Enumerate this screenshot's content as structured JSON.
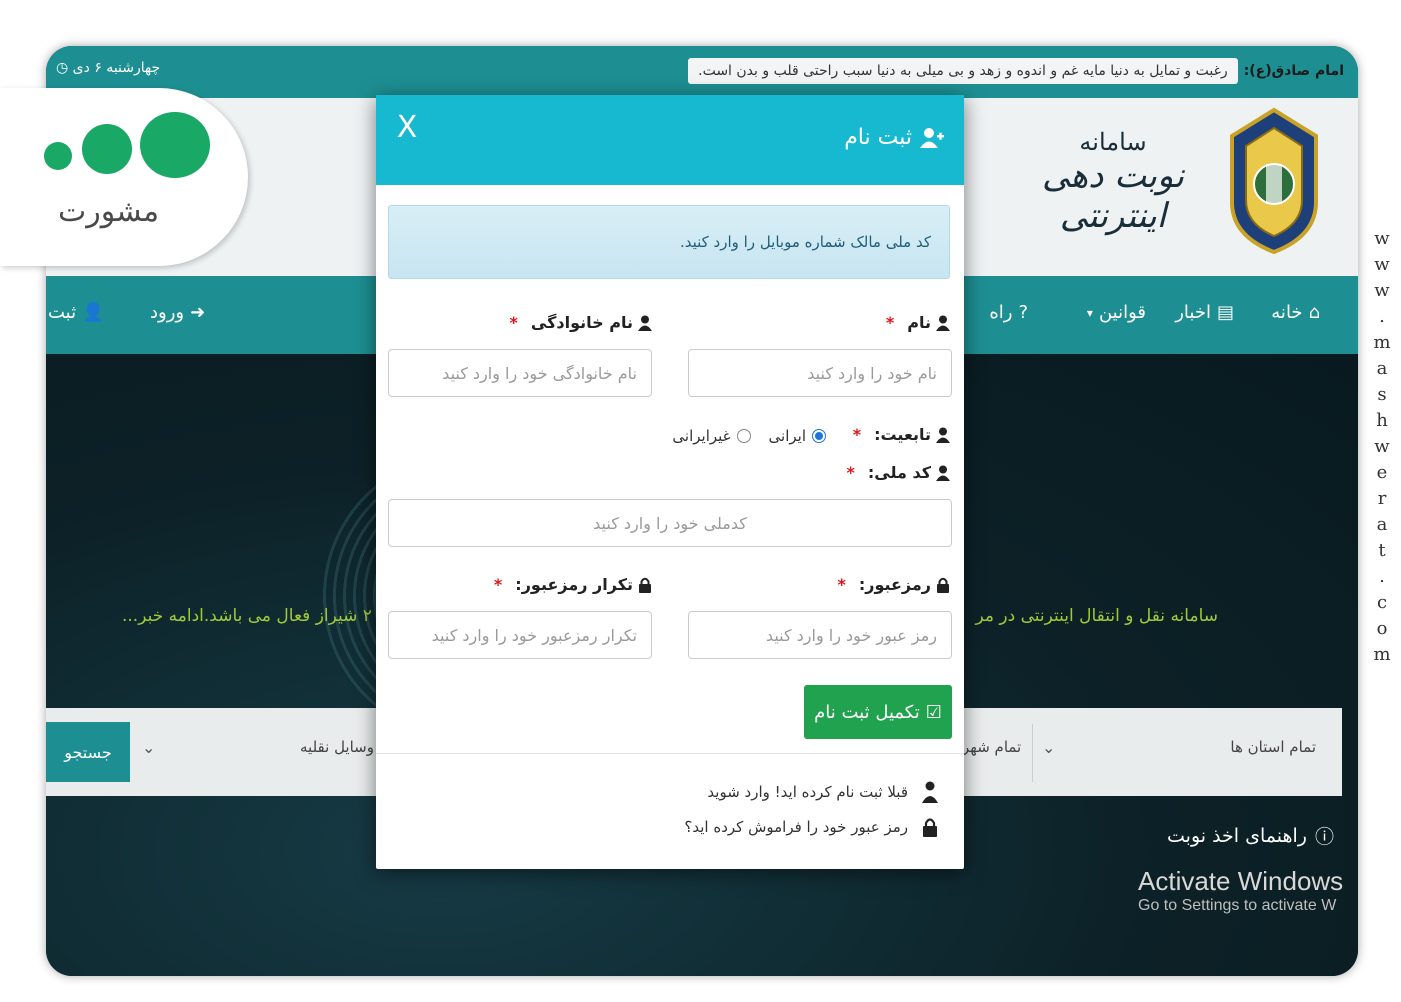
{
  "topbar": {
    "date": "چهارشنبه ۶ دی",
    "quote_label": "امام صادق(ع):",
    "quote_text": "رغبت و تمایل به دنیا مایه غم و اندوه و زهد و بی میلی به دنیا سبب راحتی قلب و بدن است."
  },
  "header": {
    "title_line1": "سامانه",
    "title_line2": "نوبت دهی اینترنتی"
  },
  "nav": {
    "home": "خانه",
    "news": "اخبار",
    "rules": "قوانین",
    "help": "راه",
    "login": "ورود",
    "register": "ثبت"
  },
  "hero": {
    "marquee_right": "سامانه نقل و انتقال اینترنتی در مر",
    "marquee_left": "۲ شیراز فعال می باشد.ادامه خبر..."
  },
  "search": {
    "province": "تمام استان ها",
    "city": "تمام شهر",
    "vehicle": "وسایل نقلیه",
    "button": "جستجو"
  },
  "guide": "راهنمای اخذ نوبت",
  "activate": {
    "line1": "Activate Windows",
    "line2": "Go to Settings to activate W"
  },
  "logo": {
    "text": "مشورت"
  },
  "watermark": [
    "w",
    "w",
    "w",
    ".",
    "m",
    "a",
    "s",
    "h",
    "w",
    "e",
    "r",
    "a",
    "t",
    ".",
    "c",
    "o",
    "m"
  ],
  "modal": {
    "title": "ثبت نام",
    "close": "X",
    "alert": "کد ملی مالک شماره موبایل را وارد کنید.",
    "first_name_label": "نام",
    "first_name_placeholder": "نام خود را وارد کنید",
    "last_name_label": "نام خانوادگی",
    "last_name_placeholder": "نام خانوادگی خود را وارد کنید",
    "nationality_label": "تابعیت:",
    "iranian": "ایرانی",
    "non_iranian": "غیرایرانی",
    "national_code_label": "کد ملی:",
    "national_code_placeholder": "کدملی خود را وارد کنید",
    "password_label": "رمزعبور:",
    "password_placeholder": "رمز عبور خود را وارد کنید",
    "password_repeat_label": "تکرار رمزعبور:",
    "password_repeat_placeholder": "تکرار رمزعبور خود را وارد کنید",
    "submit": "تکمیل ثبت نام",
    "already_registered": "قبلا ثبت نام کرده اید! وارد شوید",
    "forgot_password": "رمز عبور خود را فراموش کرده اید؟",
    "required_mark": "*"
  },
  "colors": {
    "teal": "#1d8f92",
    "modal_header": "#17b9d1",
    "submit_green": "#21a24e",
    "required_red": "#e0161b"
  }
}
